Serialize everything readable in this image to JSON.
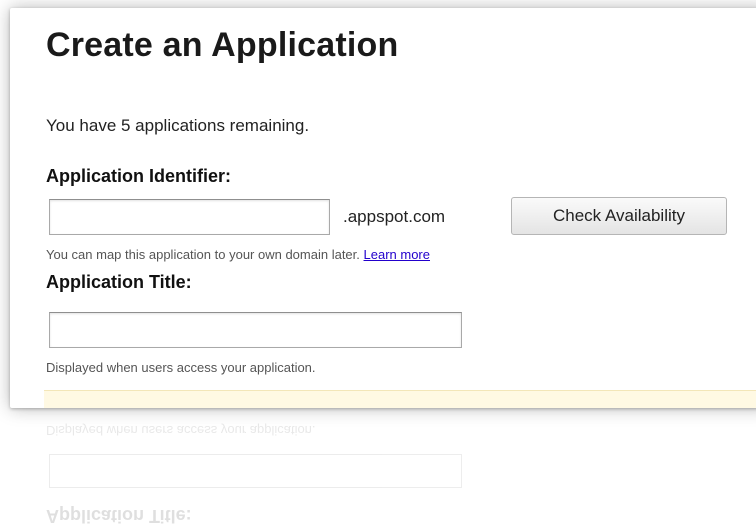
{
  "page": {
    "title": "Create an Application",
    "remaining_text": "You have 5 applications remaining."
  },
  "identifier": {
    "label": "Application Identifier:",
    "value": "",
    "placeholder": "",
    "domain_suffix": ".appspot.com",
    "check_button_label": "Check Availability",
    "hint_text": "You can map this application to your own domain later.",
    "learn_more_label": "Learn more"
  },
  "app_title": {
    "label": "Application Title:",
    "value": "",
    "placeholder": "",
    "hint_text": "Displayed when users access your application."
  },
  "colors": {
    "link": "#2200cc",
    "notice_background": "#fff9e3"
  }
}
